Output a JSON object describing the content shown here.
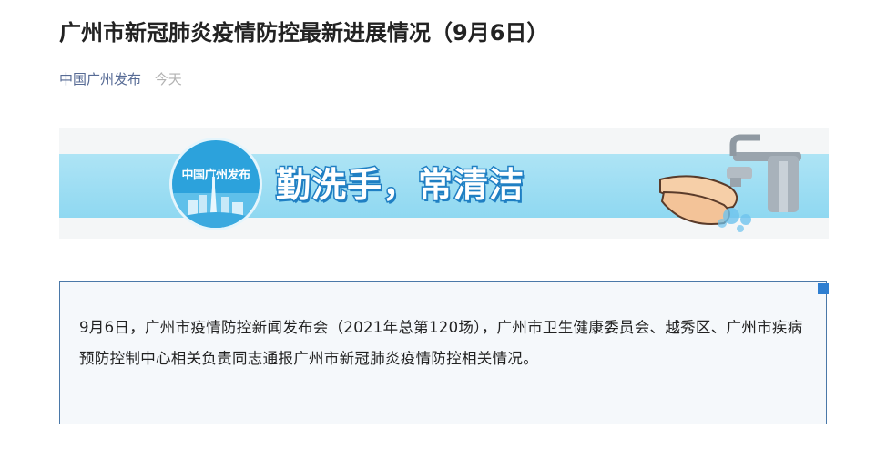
{
  "article": {
    "title": "广州市新冠肺炎疫情防控最新进展情况（9月6日）",
    "source": "中国广州发布",
    "date": "今天"
  },
  "banner": {
    "logo_text": "中国广州发布",
    "slogan": "勤洗手，常清洁"
  },
  "summary": {
    "text": "9月6日，广州市疫情防控新闻发布会（2021年总第120场），广州市卫生健康委员会、越秀区、广州市疾病预防控制中心相关负责同志通报广州市新冠肺炎疫情防控相关情况。"
  },
  "colors": {
    "source_link": "#576b95",
    "card_border": "#4a78a8",
    "card_corner": "#2f7fd1",
    "banner_stripe": "#8fd8f1",
    "slogan_stroke": "#1f7fc3"
  }
}
